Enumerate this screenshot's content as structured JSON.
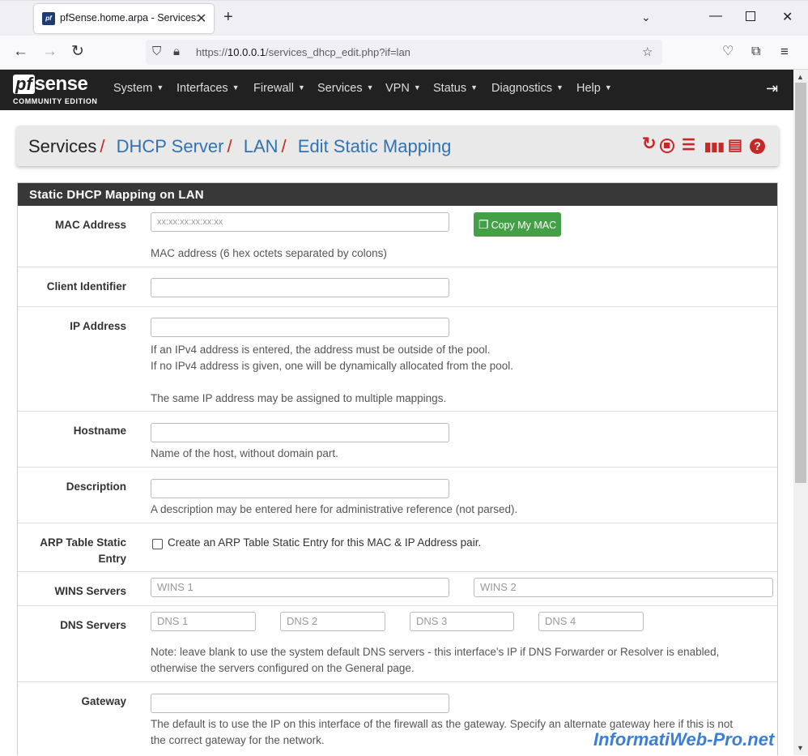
{
  "browser": {
    "tab_title": "pfSense.home.arpa - Services: D",
    "url_prefix": "https://",
    "url_host": "10.0.0.1",
    "url_path": "/services_dhcp_edit.php?if=lan"
  },
  "pfsense": {
    "logo_pf": "pf",
    "logo_sense": "sense",
    "logo_edition": "COMMUNITY EDITION",
    "menu": [
      "System",
      "Interfaces",
      "Firewall",
      "Services",
      "VPN",
      "Status",
      "Diagnostics",
      "Help"
    ]
  },
  "breadcrumb": {
    "root": "Services",
    "items": [
      "DHCP Server",
      "LAN",
      "Edit Static Mapping"
    ],
    "separator": "/"
  },
  "panel": {
    "title": "Static DHCP Mapping on LAN",
    "mac": {
      "label": "MAC Address",
      "placeholder": "xx:xx:xx:xx:xx:xx",
      "button": "Copy My MAC",
      "help": "MAC address (6 hex octets separated by colons)"
    },
    "client_id": {
      "label": "Client Identifier",
      "value": ""
    },
    "ip": {
      "label": "IP Address",
      "help1": "If an IPv4 address is entered, the address must be outside of the pool.",
      "help2": "If no IPv4 address is given, one will be dynamically allocated from the pool.",
      "help3": "The same IP address may be assigned to multiple mappings."
    },
    "hostname": {
      "label": "Hostname",
      "help": "Name of the host, without domain part."
    },
    "description": {
      "label": "Description",
      "help": "A description may be entered here for administrative reference (not parsed)."
    },
    "arp": {
      "label1": "ARP Table Static",
      "label2": "Entry",
      "checkbox_label": "Create an ARP Table Static Entry for this MAC & IP Address pair.",
      "checked": false
    },
    "wins": {
      "label": "WINS Servers",
      "placeholders": [
        "WINS 1",
        "WINS 2"
      ]
    },
    "dns": {
      "label": "DNS Servers",
      "placeholders": [
        "DNS 1",
        "DNS 2",
        "DNS 3",
        "DNS 4"
      ],
      "help1": "Note: leave blank to use the system default DNS servers - this interface's IP if DNS Forwarder or Resolver is enabled,",
      "help2": "otherwise the servers configured on the General page."
    },
    "gateway": {
      "label": "Gateway",
      "help1": "The default is to use the IP on this interface of the firewall as the gateway. Specify an alternate gateway here if this is not",
      "help2": "the correct gateway for the network."
    }
  },
  "watermark": "InformatiWeb-Pro.net"
}
